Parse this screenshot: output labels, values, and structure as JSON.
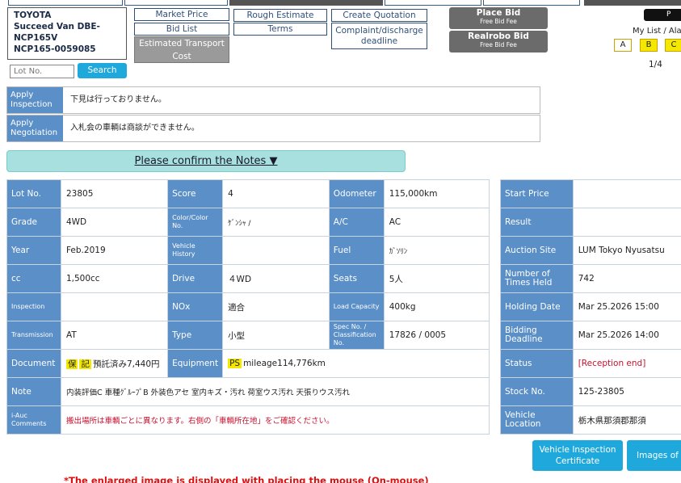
{
  "vehicle": {
    "maker": "TOYOTA",
    "model": "Succeed Van DBE-",
    "type": "NCP165V",
    "chassis": "NCP165-0059085"
  },
  "actions": {
    "market_price": "Market Price",
    "rough_estimate": "Rough Estimate",
    "create_quotation": "Create Quotation",
    "bid_list": "Bid List",
    "terms": "Terms",
    "complaint_deadline": "Complaint/discharge deadline",
    "est_transport_cost": "Estimated Transport Cost",
    "place_bid": "Place Bid",
    "place_bid_sub": "Free Bid Fee",
    "realrobo_bid": "Realrobo Bid",
    "realrobo_bid_sub": "Free Bid Fee"
  },
  "header_right": {
    "pill_label": "P",
    "mylist_label": "My List / Alar",
    "marks": [
      "A",
      "B",
      "C"
    ],
    "pager": "1/4"
  },
  "search": {
    "placeholder": "Lot No.",
    "button": "Search"
  },
  "apply": [
    {
      "label": "Apply Inspection",
      "text": "下見は行っておりません。"
    },
    {
      "label": "Apply Negotiation",
      "text": "入札会の車輌は商談ができません。"
    }
  ],
  "notes_button": "Please confirm the Notes ▼",
  "specs": {
    "lot_no": {
      "label": "Lot No.",
      "value": "23805"
    },
    "score": {
      "label": "Score",
      "value": "4"
    },
    "odometer": {
      "label": "Odometer",
      "value": "115,000km"
    },
    "grade": {
      "label": "Grade",
      "value": "4WD"
    },
    "color": {
      "label": "Color/Color No.",
      "value": "ｹﾞﾝｼｬ /"
    },
    "ac": {
      "label": "A/C",
      "value": "AC"
    },
    "year": {
      "label": "Year",
      "value": "Feb.2019"
    },
    "history": {
      "label": "Vehicle History",
      "value": ""
    },
    "fuel": {
      "label": "Fuel",
      "value": "ｶﾞｿﾘﾝ"
    },
    "cc": {
      "label": "cc",
      "value": "1,500cc"
    },
    "drive": {
      "label": "Drive",
      "value": "４WD"
    },
    "seats": {
      "label": "Seats",
      "value": "5人"
    },
    "inspection": {
      "label": "Inspection",
      "value": ""
    },
    "nox": {
      "label": "NOx",
      "value": "適合"
    },
    "load": {
      "label": "Load Capacity",
      "value": "400kg"
    },
    "transmission": {
      "label": "Transmission",
      "value": "AT"
    },
    "type": {
      "label": "Type",
      "value": "小型"
    },
    "spec_no": {
      "label": "Spec No. / Classification No.",
      "value": "17826 / 0005"
    },
    "document": {
      "label": "Document",
      "tags": [
        "保",
        "記"
      ],
      "value": "預託済み7,440円"
    },
    "equipment": {
      "label": "Equipment",
      "tags": [
        "PS"
      ],
      "value": "mileage114,776km"
    },
    "note": {
      "label": "Note",
      "value": "内装評価C 車種ｸﾞﾙｰﾌﾟB 外装色アセ 室内キズ・汚れ 荷室ウス汚れ 天張りウス汚れ"
    },
    "iauc": {
      "label": "i-Auc Comments",
      "value": "搬出場所は車輌ごとに異なります。右側の「車輌所在地」をご確認ください。"
    }
  },
  "auction": {
    "start_price": {
      "label": "Start Price",
      "value": ""
    },
    "result": {
      "label": "Result",
      "value": ""
    },
    "site": {
      "label": "Auction Site",
      "value": "LUM Tokyo Nyusatsu"
    },
    "times_held": {
      "label": "Number of Times Held",
      "value": "742"
    },
    "holding_date": {
      "label": "Holding Date",
      "value": "Mar 25.2026 15:00"
    },
    "bidding_deadline": {
      "label": "Bidding Deadline",
      "value": "Mar 25.2026 14:00"
    },
    "status": {
      "label": "Status",
      "value": "[Reception end]"
    },
    "stock_no": {
      "label": "Stock No.",
      "value": "125-23805"
    },
    "location": {
      "label": "Vehicle Location",
      "value": "栃木県那須郡那須"
    }
  },
  "bottom_buttons": {
    "inspection_cert": "Vehicle Inspection Certificate",
    "images": "Images of D"
  },
  "footnote": "*The enlarged image is displayed with placing the mouse (On-mouse)"
}
